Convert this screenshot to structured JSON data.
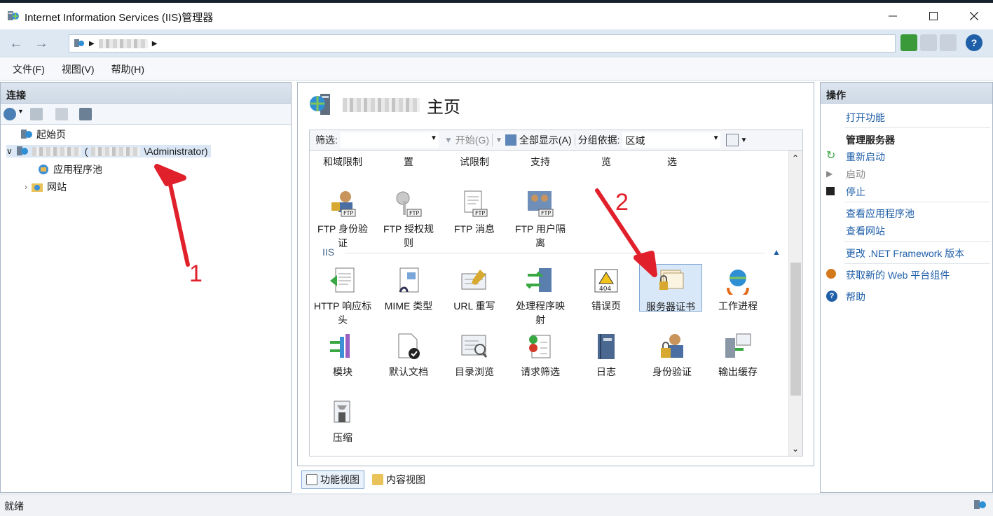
{
  "window": {
    "title": "Internet Information Services (IIS)管理器"
  },
  "address": {
    "root_icon": "server-globe-icon"
  },
  "menu": {
    "file": "文件(F)",
    "view": "视图(V)",
    "help": "帮助(H)"
  },
  "left": {
    "title": "连接",
    "tree": {
      "start_page": "起始页",
      "server_suffix": "\\Administrator)",
      "app_pools": "应用程序池",
      "sites": "网站"
    }
  },
  "center": {
    "title": "主页",
    "filter": {
      "label": "筛选:",
      "start": "开始(G)",
      "show_all": "全部显示(A)",
      "group_label": "分组依据:",
      "group_value": "区域"
    },
    "top_partial": [
      "和域限制",
      "置",
      "试限制",
      "支持",
      "览",
      "选"
    ],
    "ftp_items": [
      {
        "label1": "FTP 身份验",
        "label2": "证"
      },
      {
        "label1": "FTP 授权规",
        "label2": "则"
      },
      {
        "label1": "FTP 消息",
        "label2": ""
      },
      {
        "label1": "FTP 用户隔",
        "label2": "离"
      }
    ],
    "iis_section": "IIS",
    "iis_row1": [
      {
        "label1": "HTTP 响应标",
        "label2": "头"
      },
      {
        "label1": "MIME 类型",
        "label2": ""
      },
      {
        "label1": "URL 重写",
        "label2": ""
      },
      {
        "label1": "处理程序映",
        "label2": "射"
      },
      {
        "label1": "错误页",
        "label2": ""
      },
      {
        "label1": "服务器证书",
        "label2": ""
      },
      {
        "label1": "工作进程",
        "label2": ""
      }
    ],
    "iis_row2": [
      {
        "label1": "模块",
        "label2": ""
      },
      {
        "label1": "默认文档",
        "label2": ""
      },
      {
        "label1": "目录浏览",
        "label2": ""
      },
      {
        "label1": "请求筛选",
        "label2": ""
      },
      {
        "label1": "日志",
        "label2": ""
      },
      {
        "label1": "身份验证",
        "label2": ""
      },
      {
        "label1": "输出缓存",
        "label2": ""
      }
    ],
    "iis_row3": [
      {
        "label1": "压缩",
        "label2": ""
      }
    ],
    "view_tabs": {
      "features": "功能视图",
      "content": "内容视图"
    }
  },
  "right": {
    "title": "操作",
    "open_feature": "打开功能",
    "manage_server": "管理服务器",
    "restart": "重新启动",
    "start": "启动",
    "stop": "停止",
    "view_pools": "查看应用程序池",
    "view_sites": "查看网站",
    "change_net": "更改 .NET Framework 版本",
    "get_web": "获取新的 Web 平台组件",
    "help": "帮助"
  },
  "annotations": {
    "a1": "1",
    "a2": "2"
  },
  "status": {
    "text": "就绪"
  },
  "colors": {
    "accent": "#1f5fa8",
    "annotation": "#e0202a"
  }
}
